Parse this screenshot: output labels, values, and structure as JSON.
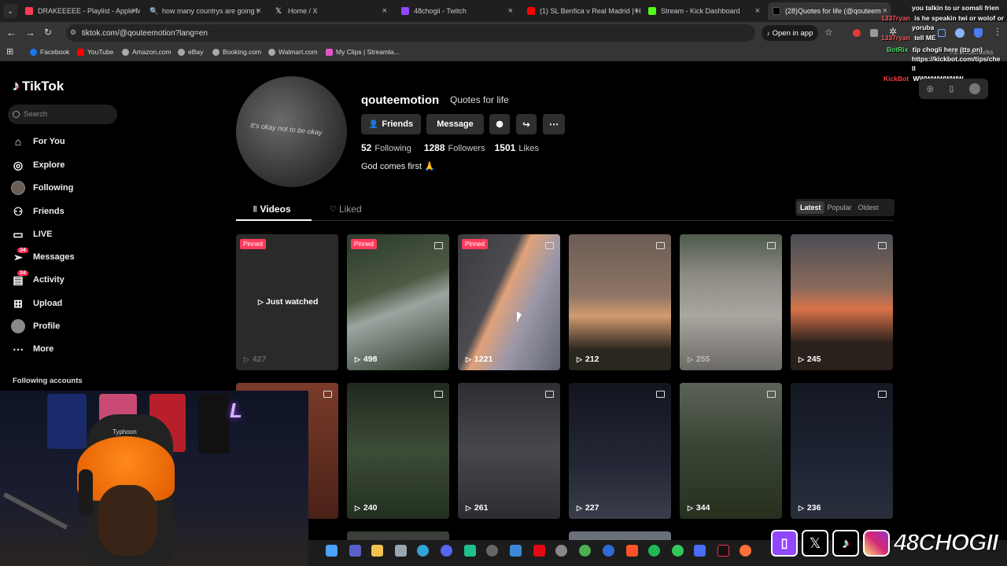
{
  "browser": {
    "tabs": [
      {
        "title": "DRAKEEEEE - Playlist - Apple M",
        "color": "#fa3b52"
      },
      {
        "title": "how many countrys are going t",
        "color": "#4285f4"
      },
      {
        "title": "Home / X",
        "color": "#ffffff"
      },
      {
        "title": "48chogii - Twitch",
        "color": "#9146ff"
      },
      {
        "title": "(1) SL Benfica v Real Madrid | H",
        "color": "#ff0000"
      },
      {
        "title": "Stream - Kick Dashboard",
        "color": "#53fc18"
      },
      {
        "title": "(28)Quotes for life (@qouteem",
        "color": "#000000"
      }
    ],
    "url": "tiktok.com/@qouteemotion?lang=en",
    "open_in_app": "Open in app",
    "bookmarks": [
      {
        "label": "Facebook",
        "color": "#1877f2"
      },
      {
        "label": "YouTube",
        "color": "#ff0000"
      },
      {
        "label": "Amazon.com",
        "color": "#aaaaaa"
      },
      {
        "label": "eBay",
        "color": "#aaaaaa"
      },
      {
        "label": "Booking.com",
        "color": "#aaaaaa"
      },
      {
        "label": "Walmart.com",
        "color": "#aaaaaa"
      },
      {
        "label": "My Clips | Streamla...",
        "color": "#e056c8"
      }
    ],
    "all_bookmarks": "All Bookmarks"
  },
  "sidebar": {
    "logo": "TikTok",
    "search_placeholder": "Search",
    "items": [
      {
        "label": "For You",
        "icon": "home-icon"
      },
      {
        "label": "Explore",
        "icon": "compass-icon"
      },
      {
        "label": "Following",
        "icon": "avatar-icon"
      },
      {
        "label": "Friends",
        "icon": "friends-icon"
      },
      {
        "label": "LIVE",
        "icon": "live-icon"
      },
      {
        "label": "Messages",
        "icon": "messages-icon",
        "badge": "34"
      },
      {
        "label": "Activity",
        "icon": "activity-icon",
        "badge": "34"
      },
      {
        "label": "Upload",
        "icon": "upload-icon"
      },
      {
        "label": "Profile",
        "icon": "profile-icon"
      },
      {
        "label": "More",
        "icon": "more-icon"
      }
    ],
    "following_accounts": "Following accounts"
  },
  "profile": {
    "username": "qouteemotion",
    "nickname": "Quotes for life",
    "avatar_text": "It's okay not to be okay",
    "buttons": {
      "friends": "Friends",
      "message": "Message"
    },
    "stats": {
      "following": "52",
      "following_label": "Following",
      "followers": "1288",
      "followers_label": "Followers",
      "likes": "1501",
      "likes_label": "Likes"
    },
    "bio": "God comes first 🙏",
    "tabs": {
      "videos": "Videos",
      "liked": "Liked"
    },
    "sort": [
      "Latest",
      "Popular",
      "Oldest"
    ]
  },
  "videos": [
    {
      "views": "427",
      "pinned": "Pinned",
      "overlay": "Just watched",
      "bg": "#2a2a2a"
    },
    {
      "views": "498",
      "pinned": "Pinned",
      "bg": "#3b4a3a"
    },
    {
      "views": "1221",
      "pinned": "Pinned",
      "bg": "#6e6f7c"
    },
    {
      "views": "212",
      "bg": "#6a5a52"
    },
    {
      "views": "255",
      "bg": "#6f6e68"
    },
    {
      "views": "245",
      "bg": "#7a4535"
    },
    {
      "views": "",
      "bg": "#5a2a20"
    },
    {
      "views": "240",
      "bg": "#2f3d2e"
    },
    {
      "views": "261",
      "bg": "#3a3b3e"
    },
    {
      "views": "227",
      "bg": "#1b1e28"
    },
    {
      "views": "344",
      "bg": "#3c4438"
    },
    {
      "views": "236",
      "bg": "#1a1f2b"
    }
  ],
  "chat": [
    {
      "user": "",
      "msg": "you talkin to ur somali frien",
      "color": "#ff5555"
    },
    {
      "user": "1337ryan",
      "msg": "is he speakin twi or wolof or",
      "color": "#ff5555"
    },
    {
      "user": "",
      "msg": "yoruba",
      "color": "#ff5555"
    },
    {
      "user": "1337ryan",
      "msg": "tell ME",
      "color": "#ff5555"
    },
    {
      "user": "BotRix",
      "msg": "tip chogli here (tts on)",
      "color": "#4cd964"
    },
    {
      "user": "",
      "msg": "https://kickbot.com/tips/che",
      "color": "#4cd964"
    },
    {
      "user": "",
      "msg": "ll",
      "color": "#4cd964"
    },
    {
      "user": "KickBot",
      "msg": "WWWWWWWW",
      "color": "#ff3b3b"
    }
  ],
  "stream": {
    "brand": "48CHOGII",
    "chair_brand": "Typhoon"
  }
}
